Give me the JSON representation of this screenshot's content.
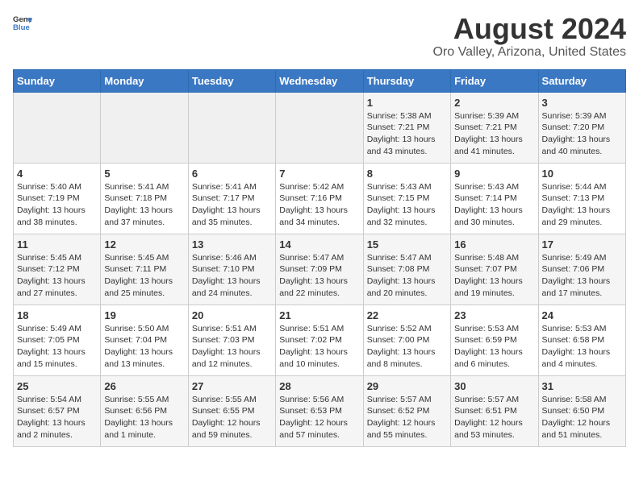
{
  "header": {
    "logo_general": "General",
    "logo_blue": "Blue",
    "main_title": "August 2024",
    "sub_title": "Oro Valley, Arizona, United States"
  },
  "calendar": {
    "days_of_week": [
      "Sunday",
      "Monday",
      "Tuesday",
      "Wednesday",
      "Thursday",
      "Friday",
      "Saturday"
    ],
    "weeks": [
      [
        {
          "date": "",
          "info": ""
        },
        {
          "date": "",
          "info": ""
        },
        {
          "date": "",
          "info": ""
        },
        {
          "date": "",
          "info": ""
        },
        {
          "date": "1",
          "info": "Sunrise: 5:38 AM\nSunset: 7:21 PM\nDaylight: 13 hours\nand 43 minutes."
        },
        {
          "date": "2",
          "info": "Sunrise: 5:39 AM\nSunset: 7:21 PM\nDaylight: 13 hours\nand 41 minutes."
        },
        {
          "date": "3",
          "info": "Sunrise: 5:39 AM\nSunset: 7:20 PM\nDaylight: 13 hours\nand 40 minutes."
        }
      ],
      [
        {
          "date": "4",
          "info": "Sunrise: 5:40 AM\nSunset: 7:19 PM\nDaylight: 13 hours\nand 38 minutes."
        },
        {
          "date": "5",
          "info": "Sunrise: 5:41 AM\nSunset: 7:18 PM\nDaylight: 13 hours\nand 37 minutes."
        },
        {
          "date": "6",
          "info": "Sunrise: 5:41 AM\nSunset: 7:17 PM\nDaylight: 13 hours\nand 35 minutes."
        },
        {
          "date": "7",
          "info": "Sunrise: 5:42 AM\nSunset: 7:16 PM\nDaylight: 13 hours\nand 34 minutes."
        },
        {
          "date": "8",
          "info": "Sunrise: 5:43 AM\nSunset: 7:15 PM\nDaylight: 13 hours\nand 32 minutes."
        },
        {
          "date": "9",
          "info": "Sunrise: 5:43 AM\nSunset: 7:14 PM\nDaylight: 13 hours\nand 30 minutes."
        },
        {
          "date": "10",
          "info": "Sunrise: 5:44 AM\nSunset: 7:13 PM\nDaylight: 13 hours\nand 29 minutes."
        }
      ],
      [
        {
          "date": "11",
          "info": "Sunrise: 5:45 AM\nSunset: 7:12 PM\nDaylight: 13 hours\nand 27 minutes."
        },
        {
          "date": "12",
          "info": "Sunrise: 5:45 AM\nSunset: 7:11 PM\nDaylight: 13 hours\nand 25 minutes."
        },
        {
          "date": "13",
          "info": "Sunrise: 5:46 AM\nSunset: 7:10 PM\nDaylight: 13 hours\nand 24 minutes."
        },
        {
          "date": "14",
          "info": "Sunrise: 5:47 AM\nSunset: 7:09 PM\nDaylight: 13 hours\nand 22 minutes."
        },
        {
          "date": "15",
          "info": "Sunrise: 5:47 AM\nSunset: 7:08 PM\nDaylight: 13 hours\nand 20 minutes."
        },
        {
          "date": "16",
          "info": "Sunrise: 5:48 AM\nSunset: 7:07 PM\nDaylight: 13 hours\nand 19 minutes."
        },
        {
          "date": "17",
          "info": "Sunrise: 5:49 AM\nSunset: 7:06 PM\nDaylight: 13 hours\nand 17 minutes."
        }
      ],
      [
        {
          "date": "18",
          "info": "Sunrise: 5:49 AM\nSunset: 7:05 PM\nDaylight: 13 hours\nand 15 minutes."
        },
        {
          "date": "19",
          "info": "Sunrise: 5:50 AM\nSunset: 7:04 PM\nDaylight: 13 hours\nand 13 minutes."
        },
        {
          "date": "20",
          "info": "Sunrise: 5:51 AM\nSunset: 7:03 PM\nDaylight: 13 hours\nand 12 minutes."
        },
        {
          "date": "21",
          "info": "Sunrise: 5:51 AM\nSunset: 7:02 PM\nDaylight: 13 hours\nand 10 minutes."
        },
        {
          "date": "22",
          "info": "Sunrise: 5:52 AM\nSunset: 7:00 PM\nDaylight: 13 hours\nand 8 minutes."
        },
        {
          "date": "23",
          "info": "Sunrise: 5:53 AM\nSunset: 6:59 PM\nDaylight: 13 hours\nand 6 minutes."
        },
        {
          "date": "24",
          "info": "Sunrise: 5:53 AM\nSunset: 6:58 PM\nDaylight: 13 hours\nand 4 minutes."
        }
      ],
      [
        {
          "date": "25",
          "info": "Sunrise: 5:54 AM\nSunset: 6:57 PM\nDaylight: 13 hours\nand 2 minutes."
        },
        {
          "date": "26",
          "info": "Sunrise: 5:55 AM\nSunset: 6:56 PM\nDaylight: 13 hours\nand 1 minute."
        },
        {
          "date": "27",
          "info": "Sunrise: 5:55 AM\nSunset: 6:55 PM\nDaylight: 12 hours\nand 59 minutes."
        },
        {
          "date": "28",
          "info": "Sunrise: 5:56 AM\nSunset: 6:53 PM\nDaylight: 12 hours\nand 57 minutes."
        },
        {
          "date": "29",
          "info": "Sunrise: 5:57 AM\nSunset: 6:52 PM\nDaylight: 12 hours\nand 55 minutes."
        },
        {
          "date": "30",
          "info": "Sunrise: 5:57 AM\nSunset: 6:51 PM\nDaylight: 12 hours\nand 53 minutes."
        },
        {
          "date": "31",
          "info": "Sunrise: 5:58 AM\nSunset: 6:50 PM\nDaylight: 12 hours\nand 51 minutes."
        }
      ]
    ]
  }
}
